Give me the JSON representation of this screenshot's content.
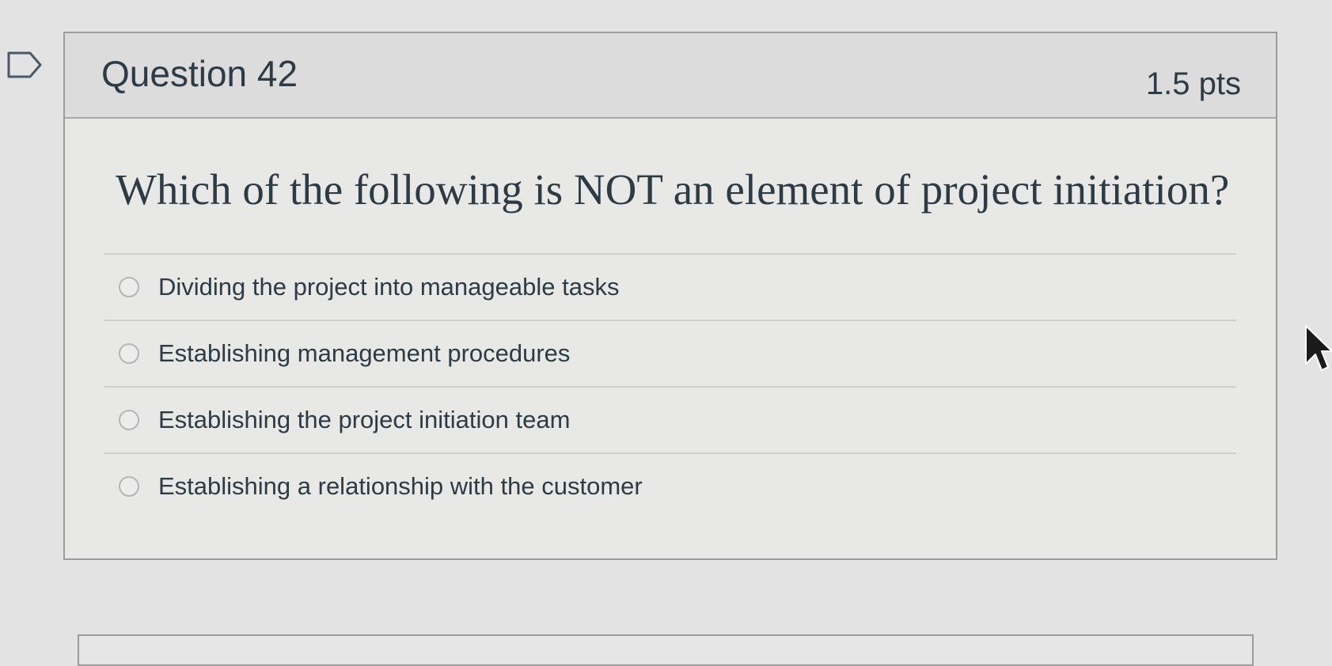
{
  "question": {
    "title": "Question 42",
    "points": "1.5 pts",
    "text": "Which of the following is NOT an element of project initiation?",
    "answers": [
      {
        "label": "Dividing the project into manageable tasks",
        "selected": false
      },
      {
        "label": "Establishing management procedures",
        "selected": false
      },
      {
        "label": "Establishing the project initiation team",
        "selected": false
      },
      {
        "label": "Establishing a relationship with the customer",
        "selected": false
      }
    ]
  },
  "icons": {
    "flag": "flag-question-icon",
    "cursor": "mouse-pointer-icon"
  },
  "colors": {
    "text": "#2d3b45",
    "header_background": "#dcdcdc",
    "card_border": "#9c9c9c"
  }
}
